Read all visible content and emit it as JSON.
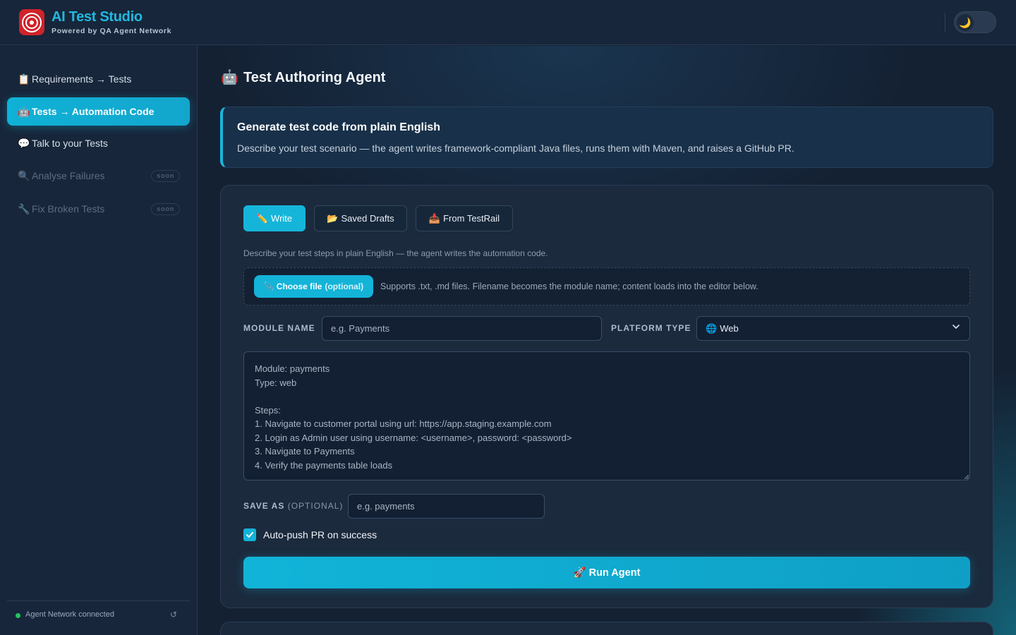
{
  "app": {
    "title": "AI Test Studio",
    "subtitle": "Powered by QA Agent Network",
    "theme_toggle_icon": "🌙"
  },
  "sidebar": {
    "items": [
      {
        "icon": "📋",
        "icon_name": "clipboard-icon",
        "label": "Requirements → Tests",
        "state": "normal"
      },
      {
        "icon": "🤖",
        "icon_name": "robot-icon",
        "label": "Tests → Automation Code",
        "state": "active"
      },
      {
        "icon": "💬",
        "icon_name": "speech-bubble-icon",
        "label": "Talk to your Tests",
        "state": "normal"
      },
      {
        "icon": "🔍",
        "icon_name": "magnifier-icon",
        "label": "Analyse Failures",
        "state": "disabled",
        "badge": "soon"
      },
      {
        "icon": "🔧",
        "icon_name": "wrench-icon",
        "label": "Fix Broken Tests",
        "state": "disabled",
        "badge": "soon"
      }
    ],
    "footer": {
      "status_text": "Agent Network connected",
      "status_color": "#22c55e",
      "refresh_icon": "↺"
    }
  },
  "main": {
    "title_icon": "🤖",
    "title": "Test Authoring Agent",
    "intro": {
      "title": "Generate test code from plain English",
      "description": "Describe your test scenario — the agent writes framework-compliant Java files, runs them with Maven, and raises a GitHub PR."
    },
    "tabs": [
      {
        "icon": "✏️",
        "label": "Write",
        "active": true
      },
      {
        "icon": "📂",
        "label": "Saved Drafts",
        "active": false
      },
      {
        "icon": "📥",
        "label": "From TestRail",
        "active": false
      }
    ],
    "help_text": "Describe your test steps in plain English — the agent writes the automation code.",
    "file_upload": {
      "icon": "📎",
      "button_label": "Choose file",
      "button_optional": "(optional)",
      "hint": "Supports .txt, .md files. Filename becomes the module name; content loads into the editor below."
    },
    "module_name": {
      "label": "MODULE NAME",
      "placeholder": "e.g. Payments",
      "value": ""
    },
    "platform_type": {
      "label": "PLATFORM TYPE",
      "icon": "🌐",
      "selected": "Web"
    },
    "editor": {
      "placeholder": "Module: payments\nType: web\n\nSteps:\n1. Navigate to customer portal using url: https://app.staging.example.com\n2. Login as Admin user using username: <username>, password: <password>\n3. Navigate to Payments\n4. Verify the payments table loads"
    },
    "save_as": {
      "label": "SAVE AS",
      "label_optional": "(OPTIONAL)",
      "placeholder": "e.g. payments",
      "value": ""
    },
    "auto_push": {
      "label": "Auto-push PR on success",
      "checked": true
    },
    "run_button": {
      "icon": "🚀",
      "label": "Run Agent"
    }
  },
  "colors": {
    "accent": "#14b3d8",
    "brand_red": "#d0232a",
    "background": "#142133"
  }
}
